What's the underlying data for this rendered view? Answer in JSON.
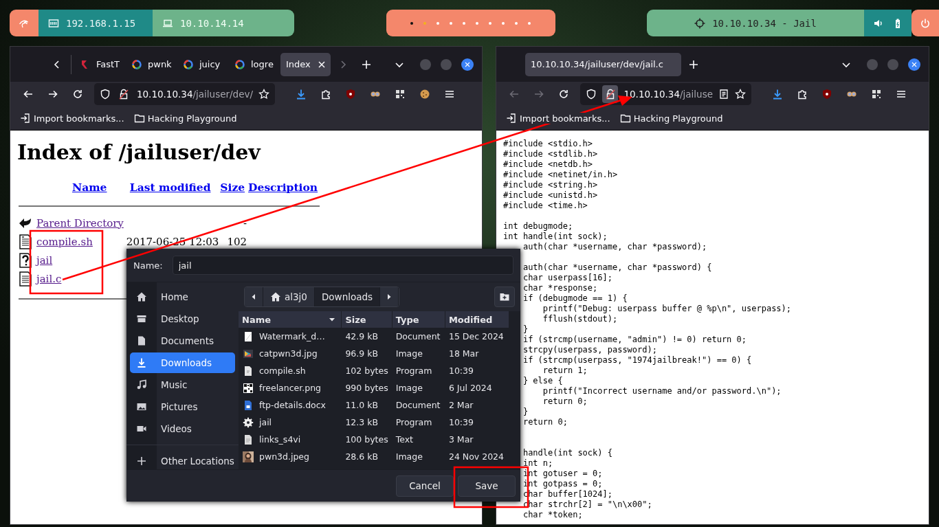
{
  "panel": {
    "chips": [
      {
        "kind": "network",
        "label": "192.168.1.15"
      },
      {
        "kind": "laptop",
        "label": "10.10.14.14"
      }
    ],
    "workspaces": [
      {
        "selected": false,
        "occupied": true
      },
      {
        "selected": true,
        "occupied": false
      },
      {
        "selected": false,
        "occupied": false
      },
      {
        "selected": false,
        "occupied": false
      },
      {
        "selected": false,
        "occupied": false
      },
      {
        "selected": false,
        "occupied": false
      },
      {
        "selected": false,
        "occupied": false
      },
      {
        "selected": false,
        "occupied": false
      },
      {
        "selected": false,
        "occupied": false
      },
      {
        "selected": false,
        "occupied": false
      }
    ],
    "target": {
      "label": "10.10.10.34 - Jail"
    }
  },
  "left_browser": {
    "tabs": [
      {
        "label": "FastT",
        "kind": "red",
        "selected": false
      },
      {
        "label": "pwnk",
        "kind": "ring",
        "selected": false
      },
      {
        "label": "juicy",
        "kind": "ring",
        "selected": false
      },
      {
        "label": "logre",
        "kind": "ring",
        "selected": false
      },
      {
        "label": "Index",
        "selected": true
      }
    ],
    "nav": {
      "back_disabled": false,
      "forward_disabled": false
    },
    "url": {
      "host": "10.10.10.34",
      "path": "/jailuser/dev/"
    },
    "bookmarks": [
      "Import bookmarks...",
      "Hacking Playground"
    ],
    "page": {
      "heading": "Index of /jailuser/dev",
      "columns": [
        "Name",
        "Last modified",
        "Size",
        "Description"
      ],
      "rows": [
        {
          "kind": "parent",
          "name": "Parent Directory",
          "size": "-"
        },
        {
          "kind": "script",
          "name": "compile.sh",
          "modified": "2017-06-25 12:03",
          "size": "102"
        },
        {
          "kind": "unknown",
          "name": "jail"
        },
        {
          "kind": "text",
          "name": "jail.c"
        }
      ]
    }
  },
  "right_browser": {
    "tabs": [
      {
        "label": "10.10.10.34/jailuser/dev/jail.c",
        "selected": true
      }
    ],
    "nav": {
      "back_disabled": true,
      "forward_disabled": true
    },
    "url": {
      "host": "10.10.10.34",
      "path": "/jailuse"
    },
    "bookmarks": [
      "Import bookmarks...",
      "Hacking Playground"
    ],
    "code_lines": [
      {
        "text": "#include <stdio.h>"
      },
      {
        "text": "#include <stdlib.h>"
      },
      {
        "text": "#include <netdb.h>"
      },
      {
        "text": "#include <netinet/in.h>"
      },
      {
        "text": "#include <string.h>"
      },
      {
        "text": "#include <unistd.h>"
      },
      {
        "text": "#include <time.h>"
      },
      {
        "text": "int debugmode;",
        "gap_before": true
      },
      {
        "text": "int handle(int sock);"
      },
      {
        "text": "    auth(char *username, char *password);"
      },
      {
        "text": "    auth(char *username, char *password) {",
        "gap_before": true
      },
      {
        "text": "    char userpass[16];"
      },
      {
        "text": "    char *response;"
      },
      {
        "text": "    if (debugmode == 1) {"
      },
      {
        "text": "        printf(\"Debug: userpass buffer @ %p\\n\", userpass);"
      },
      {
        "text": "        fflush(stdout);"
      },
      {
        "text": "    }"
      },
      {
        "text": "    if (strcmp(username, \"admin\") != 0) return 0;"
      },
      {
        "text": "    strcpy(userpass, password);"
      },
      {
        "text": "    if (strcmp(userpass, \"1974jailbreak!\") == 0) {"
      },
      {
        "text": "        return 1;"
      },
      {
        "text": "    } else {"
      },
      {
        "text": "        printf(\"Incorrect username and/or password.\\n\");"
      },
      {
        "text": "        return 0;"
      },
      {
        "text": "    }"
      },
      {
        "text": "    return 0;"
      },
      {
        "text": "    handle(int sock) {",
        "gap_before": true,
        "wide_gap": true
      },
      {
        "text": "    int n;"
      },
      {
        "text": "    int gotuser = 0;"
      },
      {
        "text": "    int gotpass = 0;"
      },
      {
        "text": "    char buffer[1024];"
      },
      {
        "text": "    char strchr[2] = \"\\n\\x00\";"
      },
      {
        "text": "    char *token;"
      }
    ]
  },
  "save_dialog": {
    "name_label": "Name:",
    "name_value": "jail",
    "places": [
      {
        "kind": "home",
        "label": "Home",
        "selected": false
      },
      {
        "kind": "desktop",
        "label": "Desktop",
        "selected": false
      },
      {
        "kind": "documents",
        "label": "Documents",
        "selected": false
      },
      {
        "kind": "downloads",
        "label": "Downloads",
        "selected": true
      },
      {
        "kind": "music",
        "label": "Music",
        "selected": false
      },
      {
        "kind": "pictures",
        "label": "Pictures",
        "selected": false
      },
      {
        "kind": "videos",
        "label": "Videos",
        "selected": false
      },
      {
        "kind": "other",
        "label": "Other Locations",
        "selected": false
      }
    ],
    "path": [
      {
        "kind": "home",
        "label": "al3j0",
        "selected": false
      },
      {
        "kind": "folder",
        "label": "Downloads",
        "selected": true
      }
    ],
    "columns": [
      {
        "label": "Name",
        "sorted": true
      },
      {
        "label": "Size",
        "sorted": false
      },
      {
        "label": "Type",
        "sorted": false
      },
      {
        "label": "Modified",
        "sorted": false
      }
    ],
    "files": [
      {
        "kind": "blank",
        "name": "Watermark_d…",
        "size": "42.9 kB",
        "type": "Document",
        "modified": "15 Dec 2024"
      },
      {
        "kind": "thumbnail",
        "name": "catpwn3d.jpg",
        "size": "96.9 kB",
        "type": "Image",
        "modified": "18 Mar"
      },
      {
        "kind": "script",
        "name": "compile.sh",
        "size": "102 bytes",
        "type": "Program",
        "modified": "10:39"
      },
      {
        "kind": "qr",
        "name": "freelancer.png",
        "size": "990 bytes",
        "type": "Image",
        "modified": "6 Jul 2024"
      },
      {
        "kind": "word",
        "name": "ftp-details.docx",
        "size": "11.0 kB",
        "type": "Document",
        "modified": "2 Mar"
      },
      {
        "kind": "executable",
        "name": "jail",
        "size": "12.3 kB",
        "type": "Program",
        "modified": "10:39"
      },
      {
        "kind": "text",
        "name": "links_s4vi",
        "size": "100 bytes",
        "type": "Text",
        "modified": "3 Mar"
      },
      {
        "name": "pwn3d.jpeg",
        "size": "28.6 kB",
        "type": "Image",
        "modified": "24 Nov 2024"
      }
    ],
    "buttons": [
      "Cancel",
      "Save"
    ]
  }
}
